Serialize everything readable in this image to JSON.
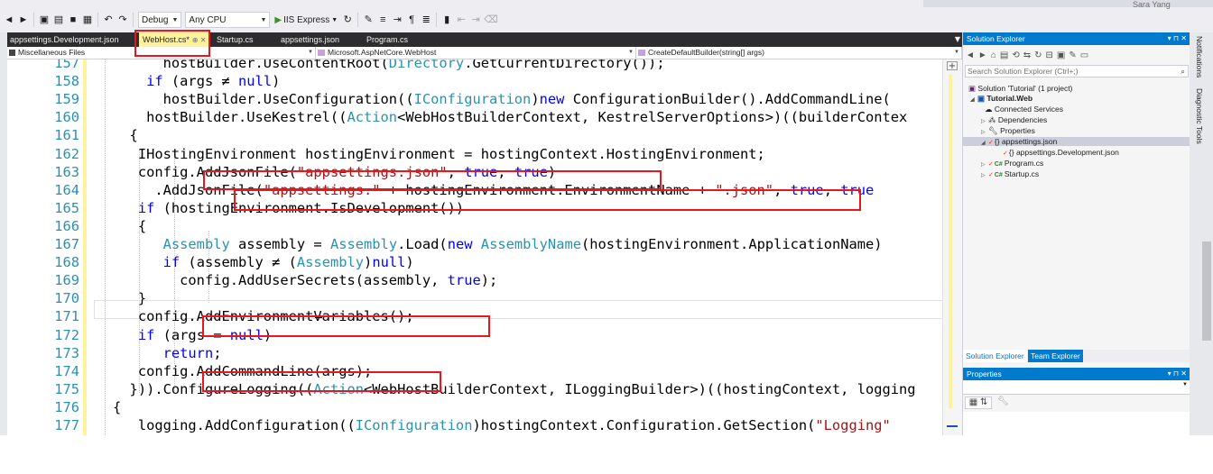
{
  "toolbar": {
    "config": "Debug",
    "platform": "Any CPU",
    "run_target": "IIS Express",
    "top_right_partial": "Sara Yang"
  },
  "tabs": [
    {
      "label": "appsettings.Development.json",
      "active": false
    },
    {
      "label": "WebHost.cs*",
      "active": true,
      "icons": "⊕ ✕"
    },
    {
      "label": "Startup.cs",
      "active": false
    },
    {
      "label": "appsettings.json",
      "active": false
    },
    {
      "label": "Program.cs",
      "active": false
    }
  ],
  "nav": {
    "project": "Miscellaneous Files",
    "type": "Microsoft.AspNetCore.WebHost",
    "member": "CreateDefaultBuilder(string[] args)"
  },
  "editor": {
    "lines": [
      {
        "num": "157",
        "indent": "      ",
        "code": [
          [
            "",
            "hostBuilder.UseContentRoot("
          ],
          [
            "ty",
            "Directory"
          ],
          [
            "",
            ".GetCurrentDirectory());"
          ]
        ]
      },
      {
        "num": "158",
        "indent": "    ",
        "code": [
          [
            "kw",
            "if"
          ],
          [
            "",
            " (args ≠ "
          ],
          [
            "kw",
            "null"
          ],
          [
            "",
            ")"
          ]
        ]
      },
      {
        "num": "159",
        "indent": "      ",
        "code": [
          [
            "",
            "hostBuilder.UseConfiguration(("
          ],
          [
            "ty",
            "IConfiguration"
          ],
          [
            "",
            ")"
          ],
          [
            "kw",
            "new"
          ],
          [
            "",
            " ConfigurationBuilder().AddCommandLine("
          ]
        ]
      },
      {
        "num": "160",
        "indent": "    ",
        "code": [
          [
            "",
            "hostBuilder.UseKestrel(("
          ],
          [
            "ty",
            "Action"
          ],
          [
            "",
            "<WebHostBuilderContext, KestrelServerOptions>)((builderContex"
          ]
        ]
      },
      {
        "num": "161",
        "indent": "  ",
        "code": [
          [
            "",
            "{"
          ]
        ]
      },
      {
        "num": "162",
        "indent": "   ",
        "code": [
          [
            "",
            "IHostingEnvironment hostingEnvironment = hostingContext.HostingEnvironment;"
          ]
        ]
      },
      {
        "num": "163",
        "indent": "   ",
        "code": [
          [
            "",
            "config.AddJsonFile("
          ],
          [
            "st",
            "\"appsettings.json\""
          ],
          [
            "",
            ", "
          ],
          [
            "kw",
            "true"
          ],
          [
            "",
            ", "
          ],
          [
            "kw",
            "true"
          ],
          [
            "",
            ")"
          ]
        ]
      },
      {
        "num": "164",
        "indent": "     ",
        "code": [
          [
            "",
            ".AddJsonFile("
          ],
          [
            "st",
            "\"appsettings.\""
          ],
          [
            "",
            " + hostingEnvironment.EnvironmentName + "
          ],
          [
            "st",
            "\".json\""
          ],
          [
            "",
            ", "
          ],
          [
            "kw",
            "true"
          ],
          [
            "",
            ", "
          ],
          [
            "kw",
            "true"
          ]
        ]
      },
      {
        "num": "165",
        "indent": "   ",
        "code": [
          [
            "kw",
            "if"
          ],
          [
            "",
            " (hostingEnvironment.IsDevelopment())"
          ]
        ]
      },
      {
        "num": "166",
        "indent": "   ",
        "code": [
          [
            "",
            "{"
          ]
        ]
      },
      {
        "num": "167",
        "indent": "      ",
        "code": [
          [
            "ty",
            "Assembly"
          ],
          [
            "",
            " assembly = "
          ],
          [
            "ty",
            "Assembly"
          ],
          [
            "",
            ".Load("
          ],
          [
            "kw",
            "new"
          ],
          [
            "",
            " "
          ],
          [
            "ty",
            "AssemblyName"
          ],
          [
            "",
            "(hostingEnvironment.ApplicationName)"
          ]
        ]
      },
      {
        "num": "168",
        "indent": "      ",
        "code": [
          [
            "kw",
            "if"
          ],
          [
            "",
            " (assembly ≠ ("
          ],
          [
            "ty",
            "Assembly"
          ],
          [
            "",
            ")"
          ],
          [
            "kw",
            "null"
          ],
          [
            "",
            ")"
          ]
        ]
      },
      {
        "num": "169",
        "indent": "        ",
        "code": [
          [
            "",
            "config.AddUserSecrets(assembly, "
          ],
          [
            "kw",
            "true"
          ],
          [
            "",
            ");"
          ]
        ]
      },
      {
        "num": "170",
        "indent": "   ",
        "code": [
          [
            "",
            "}"
          ]
        ]
      },
      {
        "num": "171",
        "indent": "   ",
        "code": [
          [
            "",
            "config.AddEnvironmentVariables();"
          ]
        ]
      },
      {
        "num": "172",
        "indent": "   ",
        "code": [
          [
            "kw",
            "if"
          ],
          [
            "",
            " (args = "
          ],
          [
            "kw",
            "null"
          ],
          [
            "",
            ")"
          ]
        ]
      },
      {
        "num": "173",
        "indent": "      ",
        "code": [
          [
            "kw",
            "return"
          ],
          [
            "",
            ";"
          ]
        ]
      },
      {
        "num": "174",
        "indent": "   ",
        "code": [
          [
            "",
            "config.AddCommandLine(args);"
          ]
        ]
      },
      {
        "num": "175",
        "indent": "  ",
        "code": [
          [
            "",
            "})).ConfigureLogging(("
          ],
          [
            "ty",
            "Action"
          ],
          [
            "",
            "<WebHostBuilderContext, ILoggingBuilder>)((hostingContext, logging"
          ]
        ]
      },
      {
        "num": "176",
        "indent": "",
        "code": [
          [
            "",
            "{"
          ]
        ]
      },
      {
        "num": "177",
        "indent": "   ",
        "code": [
          [
            "",
            "logging.AddConfiguration(("
          ],
          [
            "ty",
            "IConfiguration"
          ],
          [
            "",
            ")hostingContext.Configuration.GetSection("
          ],
          [
            "st",
            "\"Logging\""
          ]
        ]
      }
    ]
  },
  "solution_explorer": {
    "title": "Solution Explorer",
    "search_placeholder": "Search Solution Explorer (Ctrl+;)",
    "solution": "Solution 'Tutorial' (1 project)",
    "project": "Tutorial.Web",
    "items": [
      "Connected Services",
      "Dependencies",
      "Properties",
      "appsettings.json",
      "appsettings.Development.json",
      "Program.cs",
      "Startup.cs"
    ],
    "bottom_tabs": [
      "Solution Explorer",
      "Team Explorer"
    ]
  },
  "properties": {
    "title": "Properties"
  },
  "side_tabs": [
    "Notifications",
    "Diagnostic Tools"
  ]
}
